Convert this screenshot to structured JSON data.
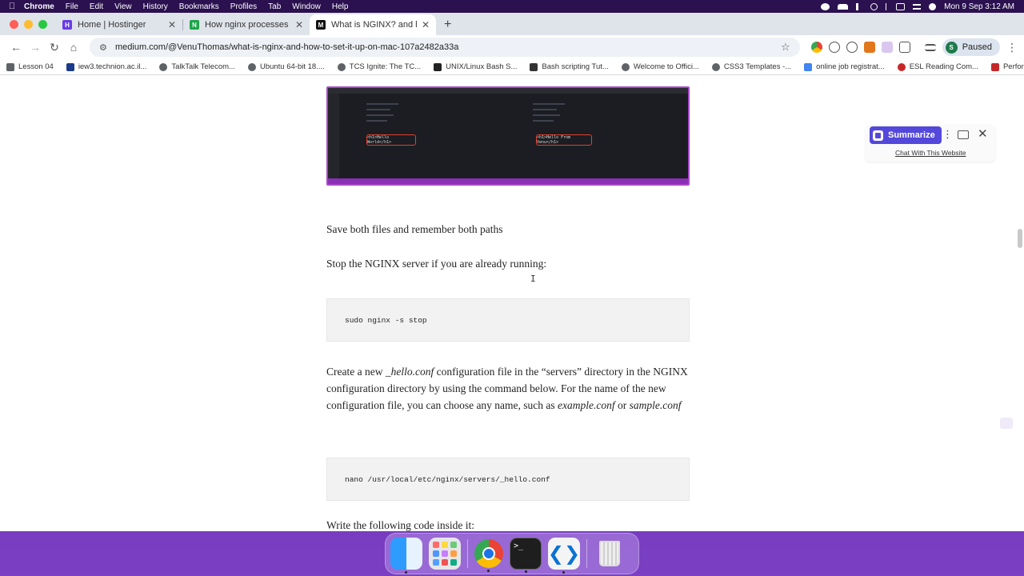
{
  "menubar": {
    "app": "Chrome",
    "items": [
      "File",
      "Edit",
      "View",
      "History",
      "Bookmarks",
      "Profiles",
      "Tab",
      "Window",
      "Help"
    ],
    "clock": "Mon 9 Sep  3:12 AM"
  },
  "tabs": [
    {
      "title": "Home | Hostinger",
      "favicon": "H",
      "color": "#673de6"
    },
    {
      "title": "How nginx processes a reque",
      "favicon": "N",
      "color": "#1ba64b"
    },
    {
      "title": "What is NGINX? and how to s",
      "favicon": "M",
      "color": "#111111"
    }
  ],
  "toolbar": {
    "url": "medium.com/@VenuThomas/what-is-nginx-and-how-to-set-it-up-on-mac-107a2482a33a",
    "profile_initial": "S",
    "profile_label": "Paused"
  },
  "bookmarks": [
    {
      "label": "Lesson 04",
      "color": "#5f6368"
    },
    {
      "label": "iew3.technion.ac.il...",
      "color": "#1a3b8b"
    },
    {
      "label": "TalkTalk Telecom...",
      "color": "#5f6368"
    },
    {
      "label": "Ubuntu 64-bit 18....",
      "color": "#5f6368"
    },
    {
      "label": "TCS Ignite: The TC...",
      "color": "#5f6368"
    },
    {
      "label": "UNIX/Linux Bash S...",
      "color": "#222222"
    },
    {
      "label": "Bash scripting Tut...",
      "color": "#333333"
    },
    {
      "label": "Welcome to Offici...",
      "color": "#5f6368"
    },
    {
      "label": "CSS3 Templates -...",
      "color": "#5f6368"
    },
    {
      "label": "online job registrat...",
      "color": "#4285f4"
    },
    {
      "label": "ESL Reading Com...",
      "color": "#c62828"
    },
    {
      "label": "Performing SQL O...",
      "color": "#c62828"
    }
  ],
  "article": {
    "embedded_screenshot": {
      "left_code": "<h1>Hello World</h1>",
      "right_code": "<h1>Hello From Venu</h1>"
    },
    "p1": "Save both files and remember both paths",
    "p2": "Stop the NGINX server if you are already running:",
    "code1": "sudo nginx -s stop",
    "p3_a": "Create a new ",
    "p3_em1": "_hello.conf",
    "p3_b": " configuration file in the “servers” directory in the NGINX configuration directory by using the command below. For the name of the new configuration file, you can choose any name, such as ",
    "p3_em2": "example.conf",
    "p3_c": " or ",
    "p3_em3": "sample.conf",
    "code2": "nano /usr/local/etc/nginx/servers/_hello.conf",
    "p4_partial": "Write the following code inside it:"
  },
  "extension": {
    "summarize_label": "Summarize",
    "chat_link": "Chat With This Website",
    "accent": "#5448db"
  },
  "cursor_glyph": "I",
  "dock": [
    "Finder",
    "Launchpad",
    "Google Chrome",
    "Terminal",
    "Visual Studio Code",
    "Trash"
  ]
}
